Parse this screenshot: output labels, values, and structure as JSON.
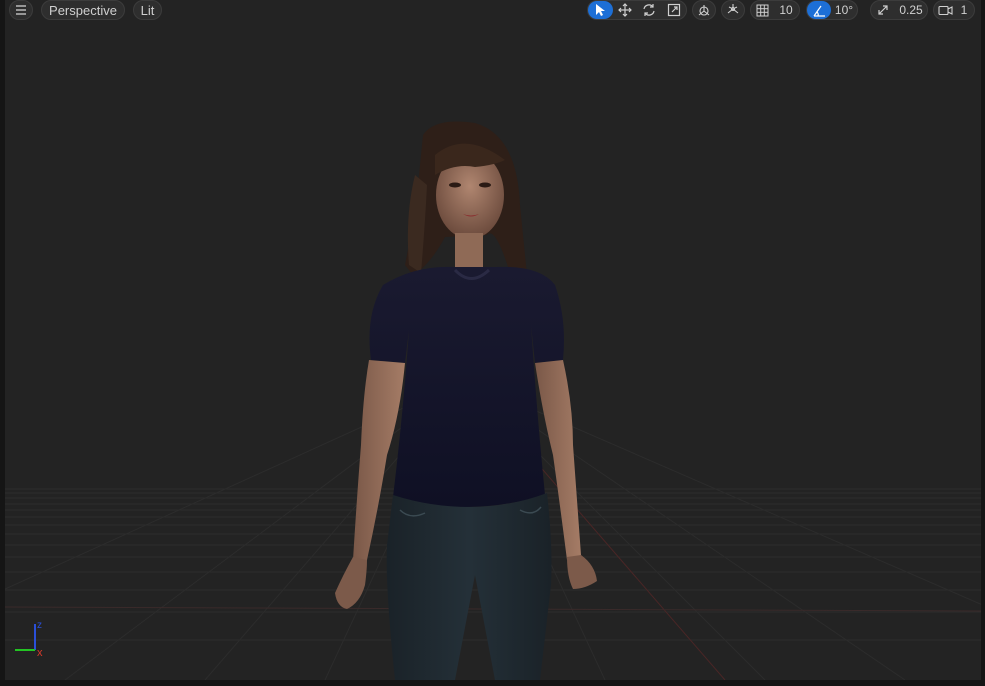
{
  "toolbar": {
    "view_mode_label": "Perspective",
    "lighting_label": "Lit",
    "grid_snap_value": "10",
    "rotation_snap_value": "10°",
    "scale_snap_value": "0.25",
    "camera_speed_value": "1"
  },
  "axis_gizmo": {
    "x_label": "x",
    "z_label": "z"
  },
  "colors": {
    "accent": "#1d6fd6",
    "viewport_bg": "#232323"
  }
}
